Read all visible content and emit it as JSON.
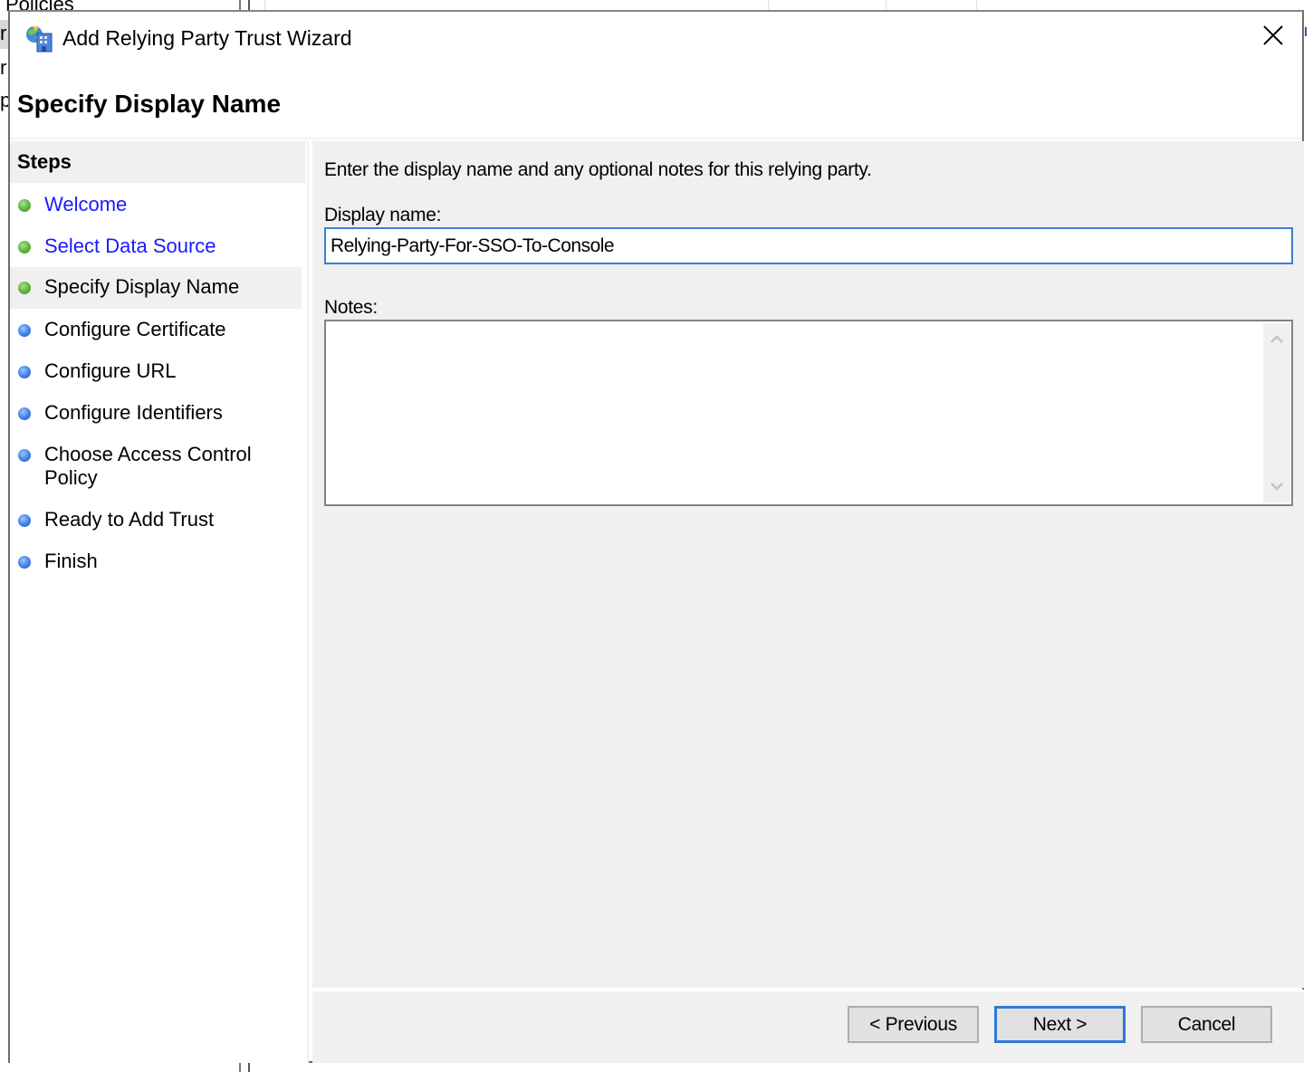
{
  "background": {
    "visible_text": "Policies"
  },
  "dialog": {
    "title": "Add Relying Party Trust Wizard",
    "icon": "relying-party-wizard-icon",
    "close_icon": "close-icon",
    "page_heading": "Specify Display Name"
  },
  "steps": {
    "header": "Steps",
    "items": [
      {
        "label": "Welcome",
        "state": "completed-link",
        "dot_color": "#5db23a"
      },
      {
        "label": "Select Data Source",
        "state": "completed-link",
        "dot_color": "#5db23a"
      },
      {
        "label": "Specify Display Name",
        "state": "current",
        "dot_color": "#5db23a"
      },
      {
        "label": "Configure Certificate",
        "state": "pending",
        "dot_color": "#3f7fe6"
      },
      {
        "label": "Configure URL",
        "state": "pending",
        "dot_color": "#3f7fe6"
      },
      {
        "label": "Configure Identifiers",
        "state": "pending",
        "dot_color": "#3f7fe6"
      },
      {
        "label": "Choose Access Control Policy",
        "state": "pending",
        "dot_color": "#3f7fe6"
      },
      {
        "label": "Ready to Add Trust",
        "state": "pending",
        "dot_color": "#3f7fe6"
      },
      {
        "label": "Finish",
        "state": "pending",
        "dot_color": "#3f7fe6"
      }
    ]
  },
  "content": {
    "intro": "Enter the display name and any optional notes for this relying party.",
    "display_name_label": "Display name:",
    "display_name_value": "Relying-Party-For-SSO-To-Console",
    "notes_label": "Notes:",
    "notes_value": ""
  },
  "footer": {
    "previous_label": "< Previous",
    "next_label": "Next >",
    "cancel_label": "Cancel"
  },
  "colors": {
    "link": "#1a1aff",
    "focus_border": "#2f79d3",
    "pane_bg": "#f0f0f0"
  }
}
